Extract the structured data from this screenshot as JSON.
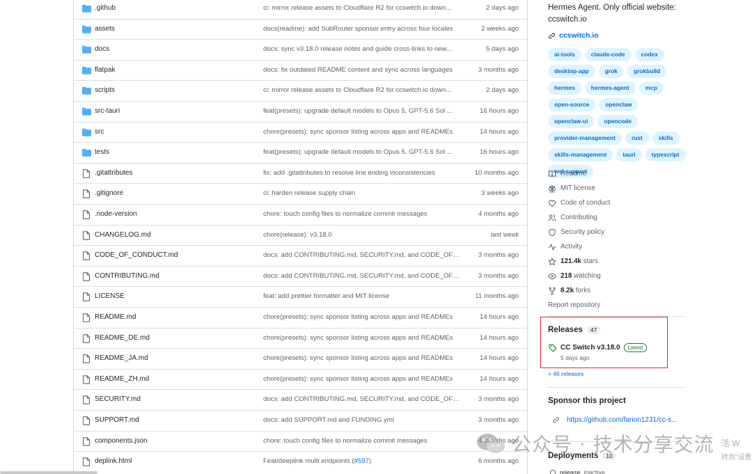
{
  "files": [
    {
      "type": "dir",
      "name": ".github",
      "message": "ci: mirror release assets to Cloudflare R2 for ccswitch.io down...",
      "age": "2 days ago"
    },
    {
      "type": "dir",
      "name": "assets",
      "message": "docs(readme): add SubRouter sponsor entry across four locales",
      "age": "2 weeks ago"
    },
    {
      "type": "dir",
      "name": "docs",
      "message": "docs: sync v3.18.0 release notes and guide cross-links to new...",
      "age": "5 days ago"
    },
    {
      "type": "dir",
      "name": "flatpak",
      "message": "docs: fix outdated README content and sync across languages",
      "age": "3 months ago"
    },
    {
      "type": "dir",
      "name": "scripts",
      "message": "ci: mirror release assets to Cloudflare R2 for ccswitch.io down...",
      "age": "2 days ago"
    },
    {
      "type": "dir",
      "name": "src-tauri",
      "message": "feat(presets): upgrade default models to Opus 5, GPT-5.6 Sol ...",
      "age": "16 hours ago"
    },
    {
      "type": "dir",
      "name": "src",
      "message": "chore(presets): sync sponsor listing across apps and READMEs",
      "age": "14 hours ago"
    },
    {
      "type": "dir",
      "name": "tests",
      "message": "feat(presets): upgrade default models to Opus 5, GPT-5.6 Sol ...",
      "age": "16 hours ago"
    },
    {
      "type": "file",
      "name": ".gitattributes",
      "message": "fix: add .gitattributes to resolve line ending inconsistencies",
      "age": "10 months ago"
    },
    {
      "type": "file",
      "name": ".gitignore",
      "message": "ci: harden release supply chain",
      "age": "3 weeks ago"
    },
    {
      "type": "file",
      "name": ".node-version",
      "message": "chore: touch config files to normalize commit messages",
      "age": "4 months ago"
    },
    {
      "type": "file",
      "name": "CHANGELOG.md",
      "message": "chore(release): v3.18.0",
      "age": "last week"
    },
    {
      "type": "file",
      "name": "CODE_OF_CONDUCT.md",
      "message": "docs: add CONTRIBUTING.md, SECURITY.md, and CODE_OF_...",
      "age": "3 months ago"
    },
    {
      "type": "file",
      "name": "CONTRIBUTING.md",
      "message": "docs: add CONTRIBUTING.md, SECURITY.md, and CODE_OF_...",
      "age": "3 months ago"
    },
    {
      "type": "file",
      "name": "LICENSE",
      "message": "feat: add prettier formatter and MIT license",
      "age": "11 months ago"
    },
    {
      "type": "file",
      "name": "README.md",
      "message": "chore(presets): sync sponsor listing across apps and READMEs",
      "age": "14 hours ago"
    },
    {
      "type": "file",
      "name": "README_DE.md",
      "message": "chore(presets): sync sponsor listing across apps and READMEs",
      "age": "14 hours ago"
    },
    {
      "type": "file",
      "name": "README_JA.md",
      "message": "chore(presets): sync sponsor listing across apps and READMEs",
      "age": "14 hours ago"
    },
    {
      "type": "file",
      "name": "README_ZH.md",
      "message": "chore(presets): sync sponsor listing across apps and READMEs",
      "age": "14 hours ago"
    },
    {
      "type": "file",
      "name": "SECURITY.md",
      "message": "docs: add CONTRIBUTING.md, SECURITY.md, and CODE_OF_...",
      "age": "3 months ago"
    },
    {
      "type": "file",
      "name": "SUPPORT.md",
      "message": "docs: add SUPPORT.md and FUNDING.yml",
      "age": "3 months ago"
    },
    {
      "type": "file",
      "name": "components.json",
      "message": "chore: touch config files to normalize commit messages",
      "age": "4 months ago"
    },
    {
      "type": "file",
      "name": "deplink.html",
      "message": "Feat/deeplink multi endpoints (",
      "message_link": "#597",
      "message_suffix": ")",
      "age": "6 months ago"
    }
  ],
  "about": {
    "description": "Hermes Agent. Only official website: ccswitch.io",
    "website": "ccswitch.io",
    "topics": [
      "ai-tools",
      "claude-code",
      "codex",
      "desktop-app",
      "grok",
      "grokbuild",
      "hermes",
      "hermes-agent",
      "mcp",
      "open-source",
      "openclaw",
      "openclaw-ui",
      "opencode",
      "provider-management",
      "rust",
      "skills",
      "skills-management",
      "tauri",
      "typescript",
      "wsl-support"
    ],
    "links": {
      "readme": "Readme",
      "license": "MIT license",
      "conduct": "Code of conduct",
      "contributing": "Contributing",
      "security": "Security policy",
      "activity": "Activity"
    },
    "stars_count": "121.4k",
    "stars_label": "stars",
    "watching_count": "218",
    "watching_label": "watching",
    "forks_count": "8.2k",
    "forks_label": "forks",
    "report": "Report repository"
  },
  "releases": {
    "title": "Releases",
    "count": "47",
    "latest_name": "CC Switch v3.18.0",
    "latest_badge": "Latest",
    "latest_date": "5 days ago",
    "more": "+ 46 releases"
  },
  "sponsor": {
    "title": "Sponsor this project",
    "link": "https://github.com/farion1231/cc-s..."
  },
  "deployments": {
    "title": "Deployments",
    "count": "10",
    "item_name": "release",
    "item_status": "inactive"
  },
  "watermark": {
    "text": "公众号 · 技术分享交流",
    "right_top": "活 W",
    "right_bottom": "转到\"设置"
  },
  "colors": {
    "link": "#0969da",
    "folder": "#54aeff",
    "topic_bg": "#ddf4ff",
    "latest_green": "#1a7f37",
    "highlight_red": "#e5242a"
  }
}
